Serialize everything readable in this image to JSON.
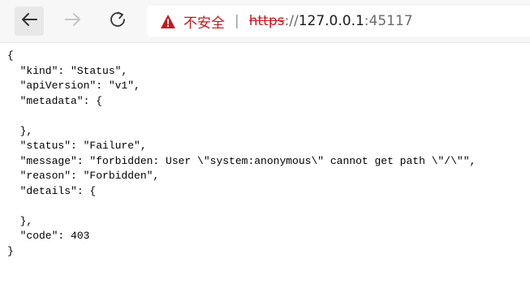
{
  "browser": {
    "back_icon": "back-arrow-icon",
    "forward_icon": "forward-arrow-icon",
    "refresh_icon": "refresh-icon",
    "security_icon": "warning-triangle-icon",
    "security_label": "不安全",
    "divider": "|",
    "url": {
      "scheme": "https",
      "separator": "://",
      "host": "127.0.0.1",
      "port": ":45117"
    },
    "colors": {
      "warning": "#c4191f",
      "toolbar_bg": "#f7f7f7"
    }
  },
  "document": {
    "lines": [
      "{",
      "  \"kind\": \"Status\",",
      "  \"apiVersion\": \"v1\",",
      "  \"metadata\": {",
      "",
      "  },",
      "  \"status\": \"Failure\",",
      "  \"message\": \"forbidden: User \\\"system:anonymous\\\" cannot get path \\\"/\\\"\",",
      "  \"reason\": \"Forbidden\",",
      "  \"details\": {",
      "",
      "  },",
      "  \"code\": 403",
      "}"
    ]
  }
}
